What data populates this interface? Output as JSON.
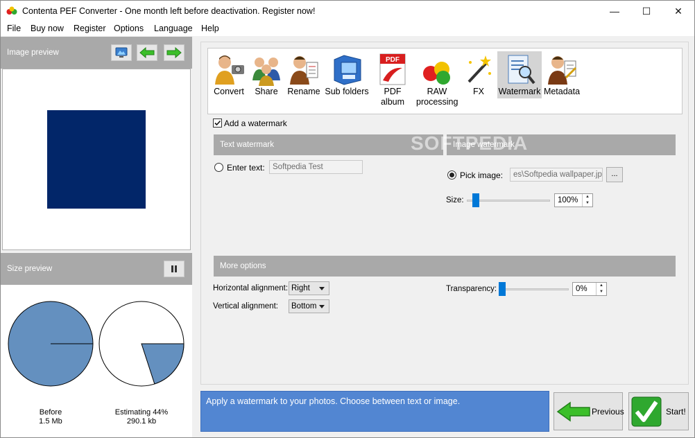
{
  "window": {
    "title": "Contenta PEF Converter  -  One month left before deactivation. Register now!",
    "controls": {
      "minimize": "—",
      "maximize": "☐",
      "close": "✕"
    }
  },
  "menu": [
    "File",
    "Buy now",
    "Register",
    "Options",
    "Language",
    "Help"
  ],
  "left_panel": {
    "image_preview_label": "Image preview",
    "size_preview_label": "Size preview",
    "before_label": "Before",
    "before_size": "1.5 Mb",
    "estimating_label": "Estimating 44%",
    "estimating_size": "290.1 kb",
    "estimate_fraction": 0.44,
    "preview_color": "#022669",
    "pie_color": "#6490bf"
  },
  "toolbar": [
    {
      "label": "Convert",
      "icon": "convert-icon"
    },
    {
      "label": "Share",
      "icon": "share-icon"
    },
    {
      "label": "Rename",
      "icon": "rename-icon"
    },
    {
      "label": "Sub folders",
      "icon": "subfolders-icon"
    },
    {
      "label": "PDF album",
      "icon": "pdf-album-icon"
    },
    {
      "label": "RAW processing",
      "icon": "raw-processing-icon"
    },
    {
      "label": "FX",
      "icon": "fx-icon"
    },
    {
      "label": "Watermark",
      "icon": "watermark-icon",
      "active": true
    },
    {
      "label": "Metadata",
      "icon": "metadata-icon"
    }
  ],
  "watermark": {
    "add_watermark_label": "Add a watermark",
    "add_watermark_checked": true,
    "text_section": "Text watermark",
    "image_section": "Image watermark",
    "enter_text_label": "Enter text:",
    "enter_text_value": "Softpedia Test",
    "pick_image_label": "Pick image:",
    "pick_image_value": "es\\Softpedia wallpaper.jpg",
    "browse_label": "...",
    "size_label": "Size:",
    "size_value": "100%",
    "more_options_section": "More options",
    "horizontal_label": "Horizontal alignment:",
    "horizontal_value": "Right",
    "vertical_label": "Vertical alignment:",
    "vertical_value": "Bottom",
    "transparency_label": "Transparency:",
    "transparency_value": "0%",
    "softpedia_watermark": "SOFTPEDIA"
  },
  "info_text": "Apply a watermark to your photos. Choose between text or image.",
  "buttons": {
    "previous": "Previous",
    "start": "Start!"
  }
}
